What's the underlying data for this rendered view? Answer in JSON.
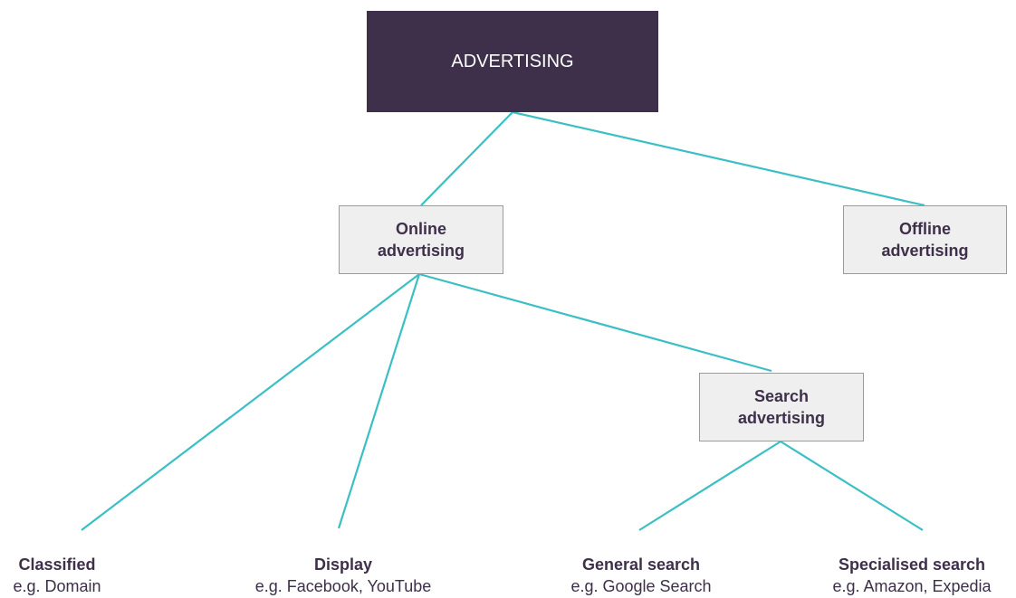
{
  "colors": {
    "root_fill": "#3e2f4a",
    "box_fill": "#efefef",
    "connector": "#3bbfc4",
    "text": "#3e2f4a"
  },
  "root": {
    "label": "ADVERTISING"
  },
  "online": {
    "label": "Online\nadvertising"
  },
  "offline": {
    "label": "Offline\nadvertising"
  },
  "search": {
    "label": "Search\nadvertising"
  },
  "leaves": [
    {
      "title": "Classified",
      "example": "e.g. Domain"
    },
    {
      "title": "Display",
      "example": "e.g. Facebook, YouTube"
    },
    {
      "title": "General search",
      "example": "e.g. Google Search"
    },
    {
      "title": "Specialised search",
      "example": "e.g. Amazon, Expedia"
    }
  ]
}
